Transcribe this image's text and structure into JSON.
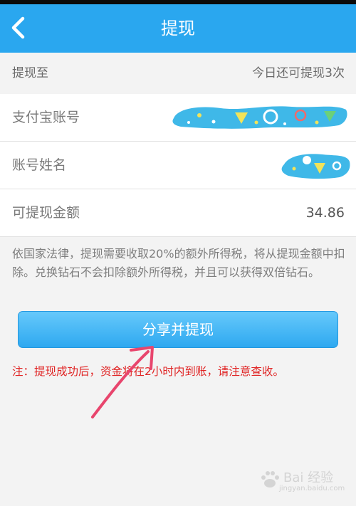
{
  "nav": {
    "title": "提现"
  },
  "section": {
    "label": "提现至",
    "remaining_hint": "今日还可提现3次"
  },
  "rows": {
    "alipay_account": {
      "label": "支付宝账号"
    },
    "account_name": {
      "label": "账号姓名"
    },
    "amount": {
      "label": "可提现金额",
      "value": "34.86"
    }
  },
  "notice": "依国家法律，提现需要收取20%的额外所得税，将从提现金额中扣除。兑换钻石不会扣除额外所得税，并且可以获得双倍钻石。",
  "submit_label": "分享并提现",
  "warning": "注：提现成功后，资金将在2小时内到账，请注意查收。",
  "watermark": {
    "text": "Bai 经验",
    "url": "jingyan.baidu.com"
  },
  "colors": {
    "nav_bg": "#2aa7ef",
    "button": "#3fb3f5",
    "warning_text": "#e02424",
    "annotation_arrow": "#e8456d",
    "redaction": "#3fb8e8"
  }
}
